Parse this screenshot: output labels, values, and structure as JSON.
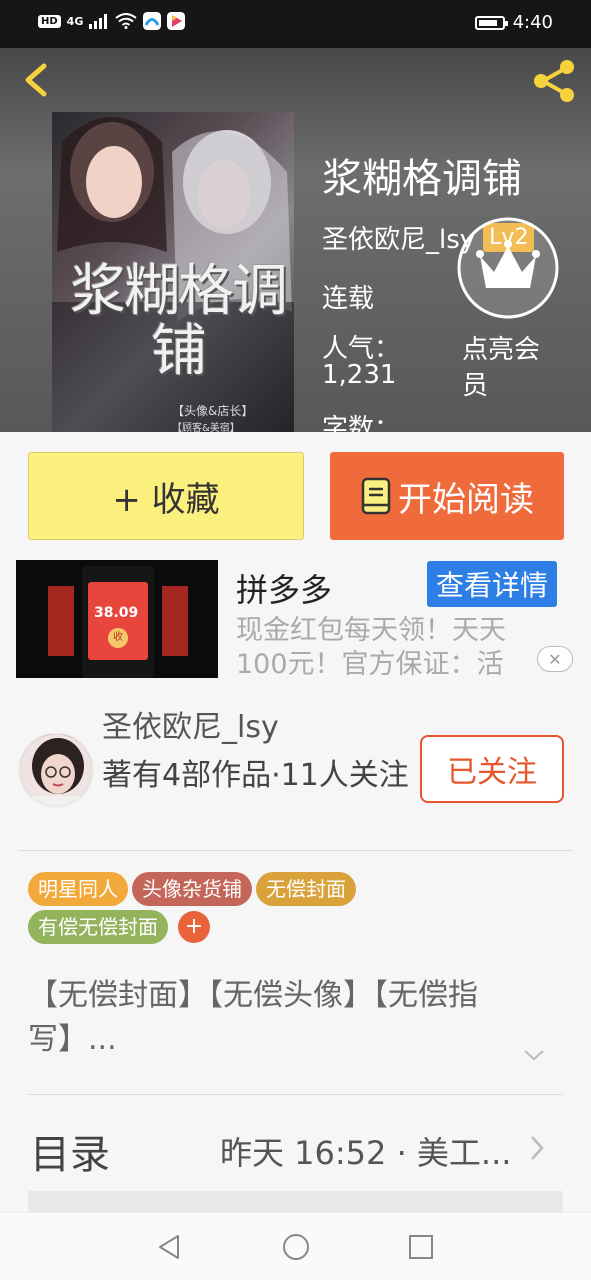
{
  "status_bar": {
    "network_hd": "HD",
    "network_gen": "4G",
    "time": "4:40",
    "battery_level": 0.8
  },
  "header": {
    "back_icon": "chevron-left-icon",
    "share_icon": "share-icon"
  },
  "book": {
    "title": "浆糊格调铺",
    "cover_title": "浆糊格调铺",
    "cover_subtitle_1": "【头像&店长】",
    "cover_subtitle_2": "【顾客&美宿】",
    "author": "圣依欧尼_lsy",
    "level": "Lv2",
    "status": "连载",
    "popularity_label": "人气：",
    "popularity_value": "1,231",
    "word_count_label": "字数：",
    "vip_label": "点亮会员"
  },
  "actions": {
    "collect_label": "+ 收藏",
    "read_label": "开始阅读"
  },
  "ad": {
    "brand": "拼多多",
    "button_label": "查看详情",
    "description": "现金红包每天领！天天100元！官方保证：活",
    "image_amount": "38.09",
    "image_coin": "收",
    "close_icon": "close-icon"
  },
  "author_card": {
    "name": "圣依欧尼_lsy",
    "meta": "著有4部作品·11人关注",
    "follow_label": "已关注"
  },
  "tags": [
    {
      "label": "明星同人",
      "color": "#f2a93b"
    },
    {
      "label": "头像杂货铺",
      "color": "#c4665a"
    },
    {
      "label": "无偿封面",
      "color": "#d9a23a"
    },
    {
      "label": "有偿无偿封面",
      "color": "#93b35c"
    }
  ],
  "tag_add_label": "+",
  "intro": "【无偿封面】【无偿头像】【无偿指写】...",
  "toc": {
    "label": "目录",
    "updated": "昨天 16:52 · 美工..."
  },
  "colors": {
    "accent_orange": "#f06b3b",
    "collect_yellow": "#fbf07d",
    "ad_blue": "#2d7fe6",
    "level_gold": "#f0b238"
  }
}
